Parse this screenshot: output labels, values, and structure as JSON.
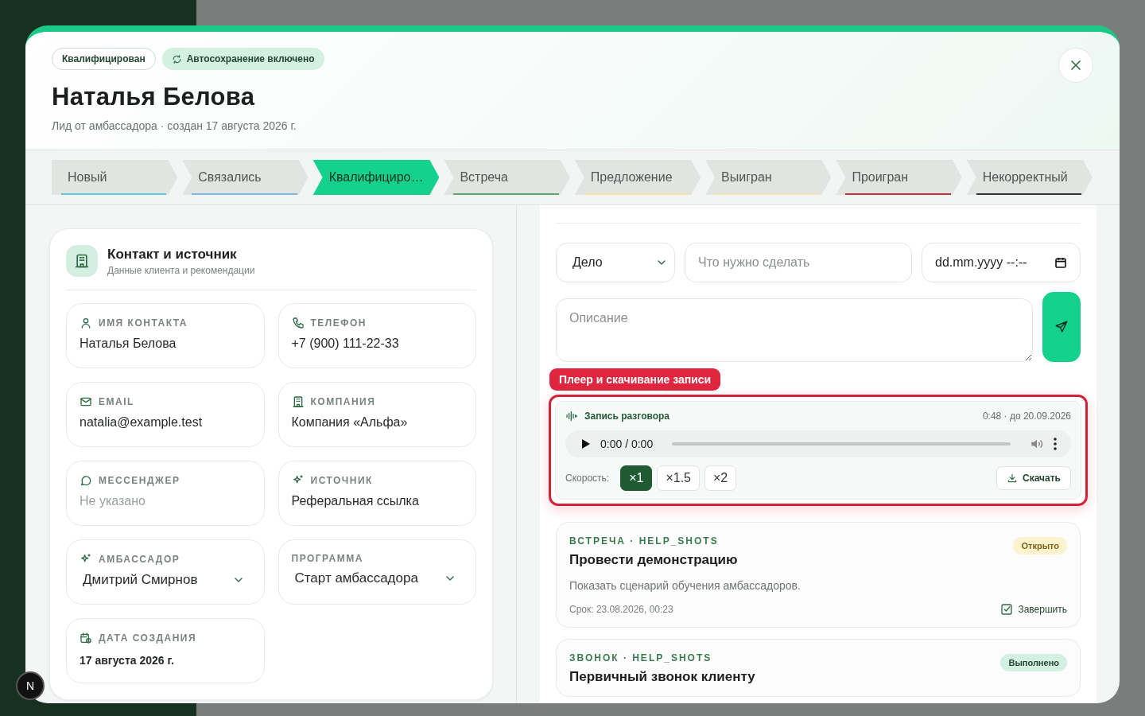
{
  "header": {
    "status_badge": "Квалифицирован",
    "autosave_badge": "Автосохранение включено",
    "title": "Наталья Белова",
    "subtitle": "Лид от амбассадора · создан 17 августа 2026 г."
  },
  "stages": [
    {
      "label": "Новый",
      "selected": false,
      "color": "#5cc9d6"
    },
    {
      "label": "Связались",
      "selected": false,
      "color": "#7db8e2"
    },
    {
      "label": "Квалифициро…",
      "selected": true
    },
    {
      "label": "Встреча",
      "selected": false,
      "color": "#5aa86c"
    },
    {
      "label": "Предложение",
      "selected": false,
      "color": "#f3e3a6"
    },
    {
      "label": "Выигран",
      "selected": false,
      "color": "#f1e6b3"
    },
    {
      "label": "Проигран",
      "selected": false,
      "color": "#c62f3b"
    },
    {
      "label": "Некорректный",
      "selected": false,
      "color": "#2b3838"
    }
  ],
  "contact_card": {
    "title": "Контакт и источник",
    "subtitle": "Данные клиента и рекомендации",
    "fields": [
      {
        "kind": "text",
        "label": "ИМЯ КОНТАКТА",
        "value": "Наталья Белова"
      },
      {
        "kind": "text",
        "label": "ТЕЛЕФОН",
        "value": "+7 (900) 111-22-33"
      },
      {
        "kind": "text",
        "label": "EMAIL",
        "value": "natalia@example.test"
      },
      {
        "kind": "text",
        "label": "КОМПАНИЯ",
        "value": "Компания «Альфа»"
      },
      {
        "kind": "empty",
        "label": "МЕССЕНДЖЕР",
        "value": "Не указано"
      },
      {
        "kind": "text",
        "label": "ИСТОЧНИК",
        "value": "Реферальная ссылка"
      },
      {
        "kind": "select",
        "label": "АМБАССАДОР",
        "value": "Дмитрий Смирнов"
      },
      {
        "kind": "select",
        "label": "ПРОГРАММА",
        "value": "Старт амбассадора"
      },
      {
        "kind": "date",
        "label": "ДАТА СОЗДАНИЯ",
        "value": "17 августа 2026 г."
      }
    ]
  },
  "task_form": {
    "type_select": "Дело",
    "task_field": {
      "placeholder": "Что нужно сделать"
    },
    "date_field": "dd.mm.yyyy --:--",
    "description_field": {
      "placeholder": "Описание"
    }
  },
  "callout": "Плеер и скачивание записи",
  "recording": {
    "title": "Запись разговора",
    "meta": "0:48 · до 20.09.2026",
    "time": "0:00 / 0:00",
    "speed_label": "Скорость:",
    "speeds": [
      {
        "label": "×1",
        "selected": true
      },
      {
        "label": "×1.5",
        "selected": false
      },
      {
        "label": "×2",
        "selected": false
      }
    ],
    "download": "Скачать"
  },
  "tasks": [
    {
      "type": "ВСТРЕЧА · HELP_SHOTS",
      "title": "Провести демонстрацию",
      "status": "Открыто",
      "kind": "open",
      "description": "Показать сценарий обучения амбассадоров.",
      "due": "Срок: 23.08.2026, 00:23",
      "action": "Завершить"
    },
    {
      "type": "ЗВОНОК · HELP_SHOTS",
      "title": "Первичный звонок клиенту",
      "status": "Выполнено",
      "kind": "done"
    }
  ],
  "dev_badge": "N"
}
